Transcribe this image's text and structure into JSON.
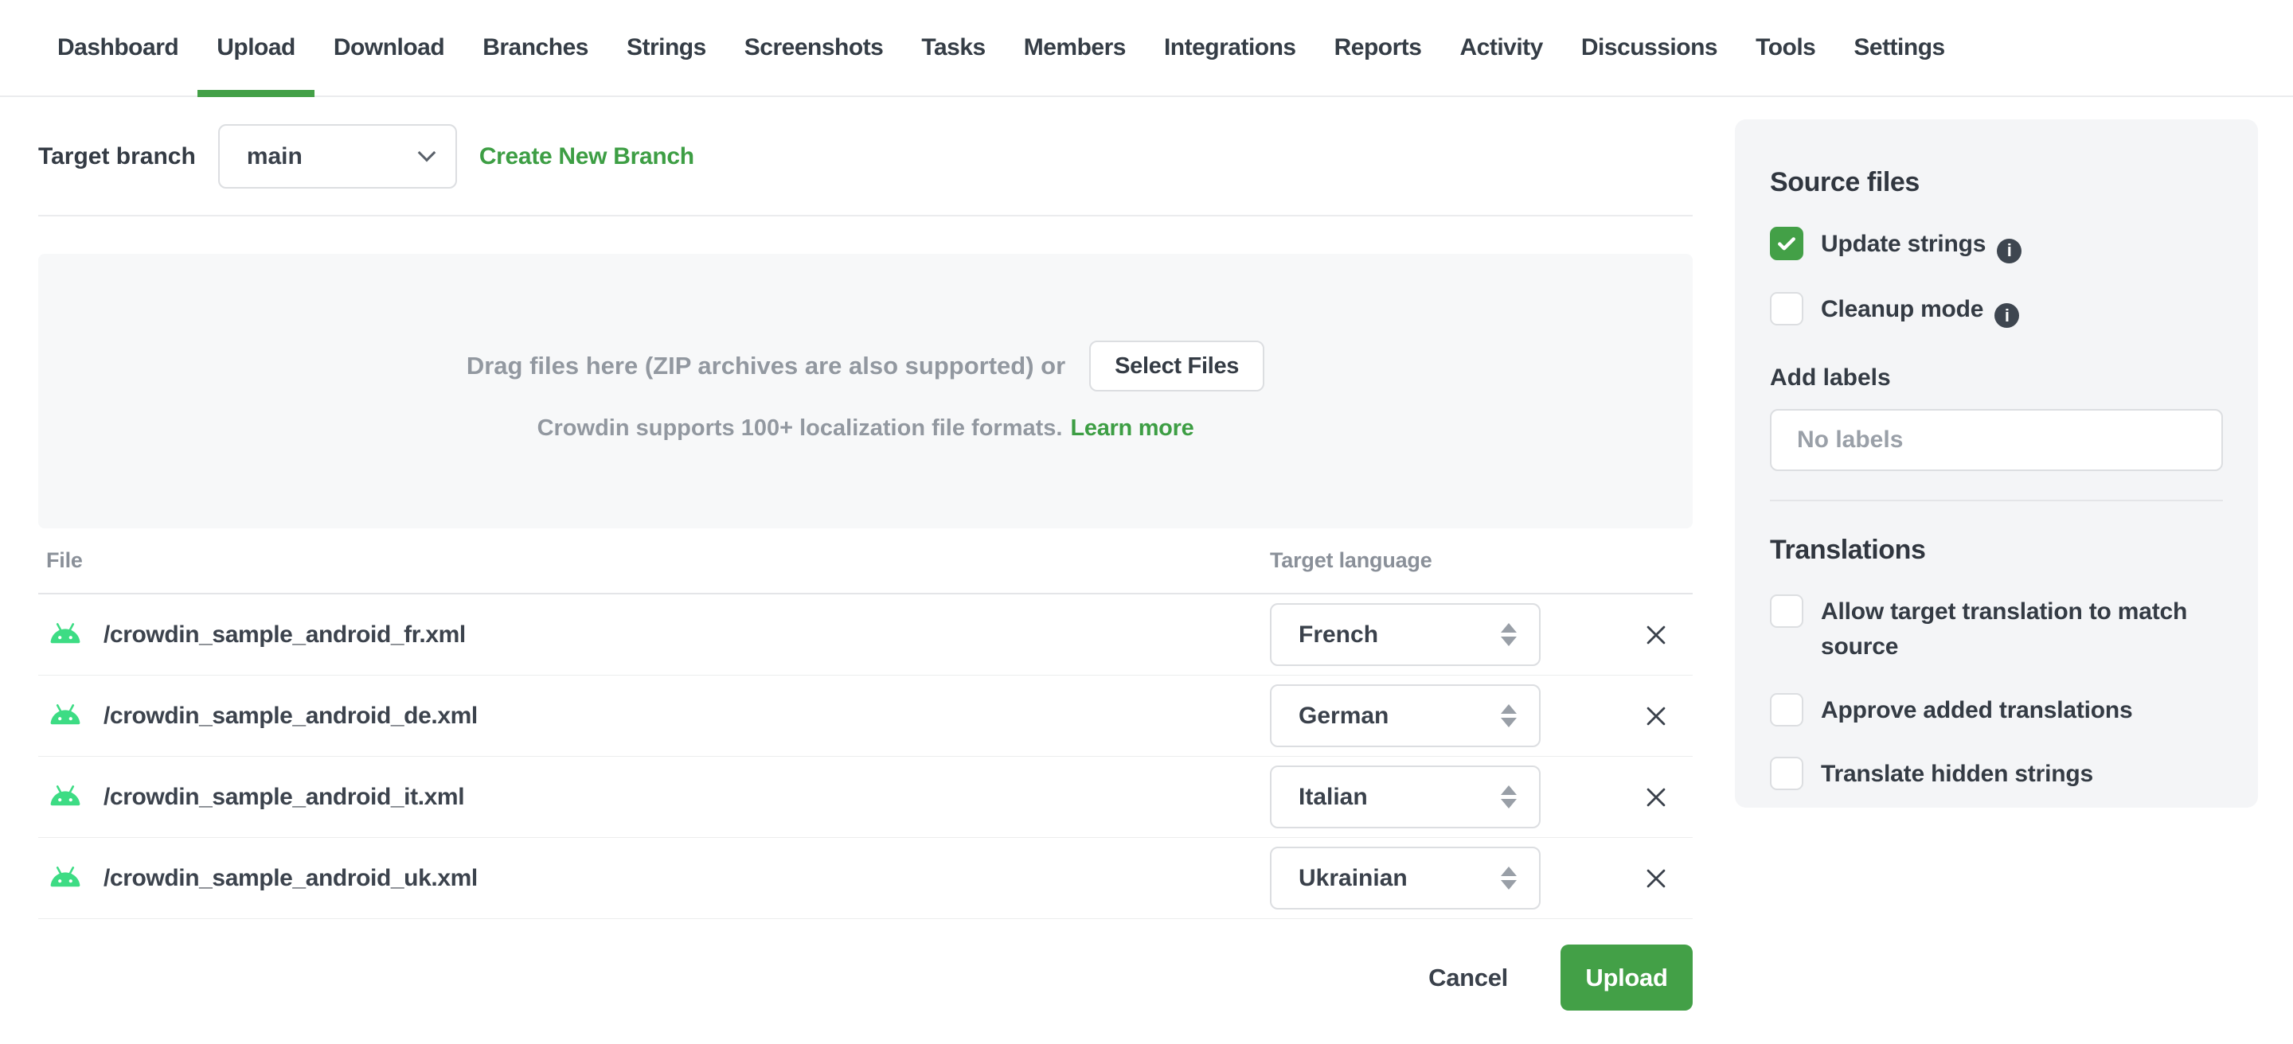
{
  "colors": {
    "accent": "#43a047",
    "link": "#3d9e44",
    "android": "#3ddc84"
  },
  "nav": {
    "items": [
      {
        "label": "Dashboard",
        "active": false
      },
      {
        "label": "Upload",
        "active": true
      },
      {
        "label": "Download",
        "active": false
      },
      {
        "label": "Branches",
        "active": false
      },
      {
        "label": "Strings",
        "active": false
      },
      {
        "label": "Screenshots",
        "active": false
      },
      {
        "label": "Tasks",
        "active": false
      },
      {
        "label": "Members",
        "active": false
      },
      {
        "label": "Integrations",
        "active": false
      },
      {
        "label": "Reports",
        "active": false
      },
      {
        "label": "Activity",
        "active": false
      },
      {
        "label": "Discussions",
        "active": false
      },
      {
        "label": "Tools",
        "active": false
      },
      {
        "label": "Settings",
        "active": false
      }
    ]
  },
  "branch": {
    "label": "Target branch",
    "selected": "main",
    "create_link": "Create New Branch"
  },
  "dropzone": {
    "drag_text": "Drag files here (ZIP archives are also supported) or",
    "select_button": "Select Files",
    "formats_text": "Crowdin supports 100+ localization file formats.",
    "learn_more": "Learn more"
  },
  "table": {
    "file_header": "File",
    "language_header": "Target language",
    "rows": [
      {
        "file": "/crowdin_sample_android_fr.xml",
        "language": "French",
        "icon": "android-robot-icon",
        "remove_icon": "x-icon"
      },
      {
        "file": "/crowdin_sample_android_de.xml",
        "language": "German",
        "icon": "android-robot-icon",
        "remove_icon": "x-icon"
      },
      {
        "file": "/crowdin_sample_android_it.xml",
        "language": "Italian",
        "icon": "android-robot-icon",
        "remove_icon": "x-icon"
      },
      {
        "file": "/crowdin_sample_android_uk.xml",
        "language": "Ukrainian",
        "icon": "android-robot-icon",
        "remove_icon": "x-icon"
      }
    ]
  },
  "footer": {
    "cancel": "Cancel",
    "upload": "Upload"
  },
  "sidebar": {
    "source_files": {
      "title": "Source files",
      "options": [
        {
          "label": "Update strings",
          "checked": true,
          "info": true
        },
        {
          "label": "Cleanup mode",
          "checked": false,
          "info": true
        }
      ]
    },
    "labels": {
      "title": "Add labels",
      "placeholder": "No labels"
    },
    "translations": {
      "title": "Translations",
      "options": [
        {
          "label": "Allow target translation to match source",
          "checked": false,
          "info": false
        },
        {
          "label": "Approve added translations",
          "checked": false,
          "info": false
        },
        {
          "label": "Translate hidden strings",
          "checked": false,
          "info": false
        }
      ]
    }
  }
}
